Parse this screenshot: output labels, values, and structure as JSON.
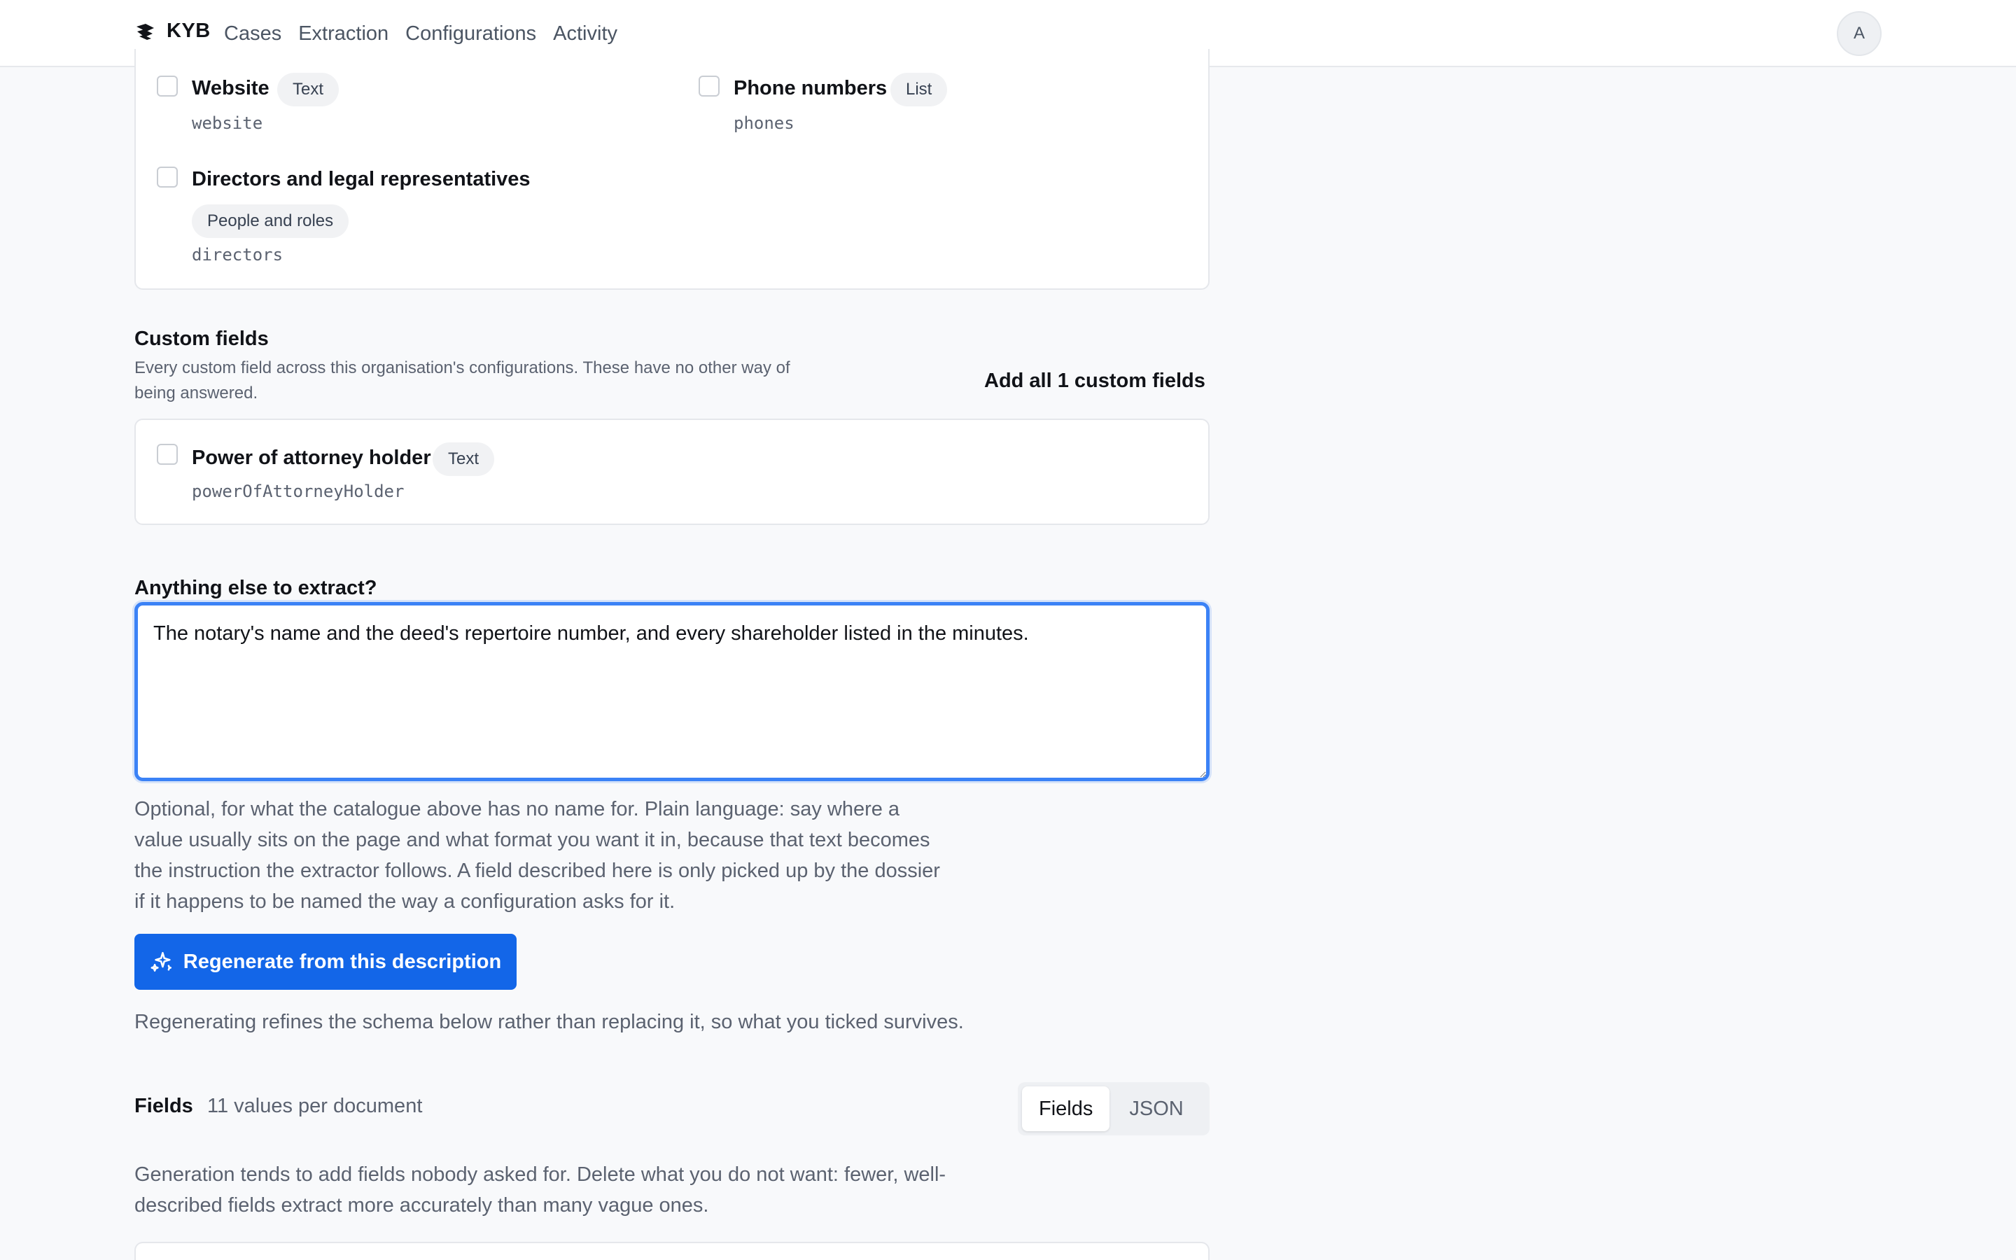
{
  "app": {
    "brand": "KYB"
  },
  "nav": {
    "items": [
      "Cases",
      "Extraction",
      "Configurations",
      "Activity"
    ]
  },
  "user": {
    "avatar_initial": "A"
  },
  "catalogue": {
    "fields": [
      {
        "label": "Website",
        "type": "Text",
        "key": "website"
      },
      {
        "label": "Phone numbers",
        "type": "List",
        "key": "phones"
      },
      {
        "label": "Directors and legal representatives",
        "type": "People and roles",
        "key": "directors"
      }
    ]
  },
  "custom": {
    "title": "Custom fields",
    "description": "Every custom field across this organisation's configurations. These have no other way of being answered.",
    "add_all_label": "Add all 1 custom fields",
    "fields": [
      {
        "label": "Power of attorney holder",
        "type": "Text",
        "key": "powerOfAttorneyHolder"
      }
    ]
  },
  "extra": {
    "label": "Anything else to extract?",
    "value": "The notary's name and the deed's repertoire number, and every shareholder listed in the minutes.",
    "help": "Optional, for what the catalogue above has no name for. Plain language: say where a value usually sits on the page and what format you want it in, because that text becomes the instruction the extractor follows. A field described here is only picked up by the dossier if it happens to be named the way a configuration asks for it.",
    "regenerate_label": "Regenerate from this description",
    "regenerate_note": "Regenerating refines the schema below rather than replacing it, so what you ticked survives."
  },
  "fields_section": {
    "title": "Fields",
    "count": "11 values per document",
    "view_options": [
      "Fields",
      "JSON"
    ],
    "active_view": "Fields",
    "note": "Generation tends to add fields nobody asked for. Delete what you do not want: fewer, well-described fields extract more accurately than many vague ones."
  },
  "colors": {
    "accent": "#1366e8",
    "focus": "#3b82f6",
    "muted": "#5b6270"
  },
  "icons": {
    "brand": "kyb-logo-icon",
    "regenerate": "sparkles-icon"
  }
}
